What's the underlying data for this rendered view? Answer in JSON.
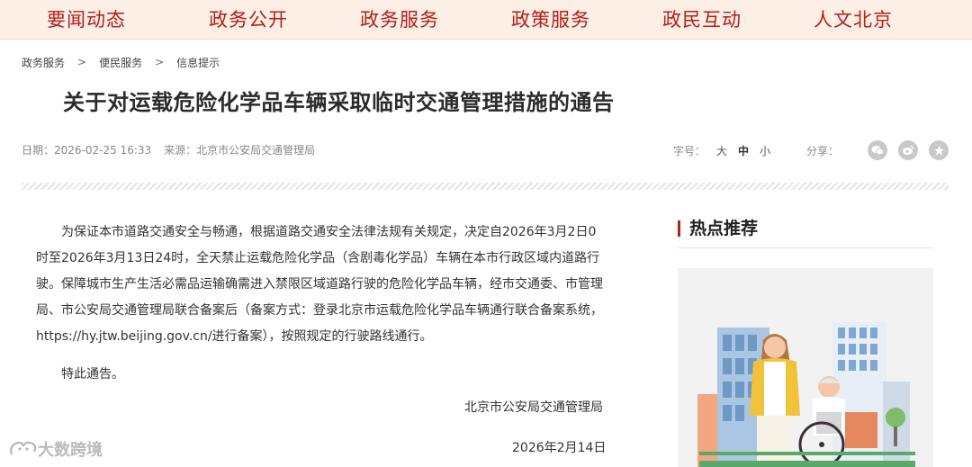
{
  "nav": {
    "items": [
      {
        "label": "要闻动态"
      },
      {
        "label": "政务公开"
      },
      {
        "label": "政务服务"
      },
      {
        "label": "政策服务"
      },
      {
        "label": "政民互动"
      },
      {
        "label": "人文北京"
      }
    ]
  },
  "breadcrumb": {
    "items": [
      "政务服务",
      "便民服务",
      "信息提示"
    ],
    "separator": ">"
  },
  "article": {
    "title": "关于对运载危险化学品车辆采取临时交通管理措施的通告",
    "date": "日期：2026-02-25 16:33",
    "source": "来源：北京市公安局交通管理局",
    "body_paragraph": "为保证本市道路交通安全与畅通，根据道路交通安全法律法规有关规定，决定自2026年3月2日0时至2026年3月13日24时，全天禁止运载危险化学品（含剧毒化学品）车辆在本市行政区域内道路行驶。保障城市生产生活必需品运输确需进入禁限区域道路行驶的危险化学品车辆，经市交通委、市管理局、市公安局交通管理局联合备案后（备案方式：登录北京市运载危险化学品车辆通行联合备案系统，https://hy.jtw.beijing.gov.cn/进行备案），按照规定的行驶路线通行。",
    "notice": "特此通告。",
    "signature_org": "北京市公安局交通管理局",
    "signature_date": "2026年2月14日"
  },
  "tools": {
    "font_label": "字号：",
    "font_large": "大",
    "font_medium": "中",
    "font_small": "小",
    "share_label": "分享：",
    "share_icons": [
      "wechat-icon",
      "weibo-icon",
      "favorite-icon"
    ]
  },
  "sidebar": {
    "hot_title": "热点推荐"
  },
  "watermark": {
    "text": "大数跨境"
  },
  "colors": {
    "brand_red": "#b41f1a",
    "nav_bg": "#fbefe6"
  }
}
